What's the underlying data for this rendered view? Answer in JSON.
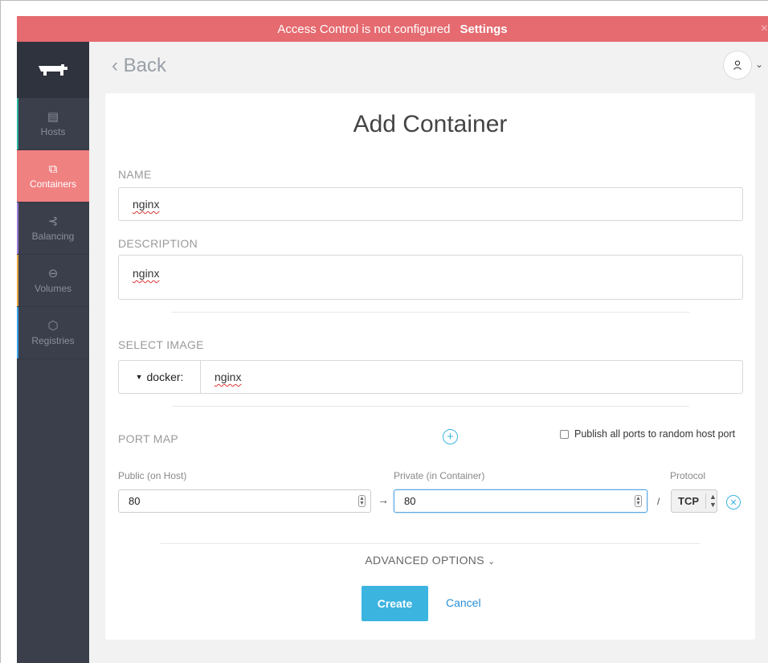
{
  "banner": {
    "message": "Access Control is not configured",
    "link": "Settings",
    "close": "×",
    "color": "#e56b70"
  },
  "sidebar": {
    "items": [
      {
        "label": "Hosts",
        "icon": "hosts-icon",
        "glyph": "▤",
        "accent": "#2bb3a0"
      },
      {
        "label": "Containers",
        "icon": "containers-icon",
        "glyph": "⧉",
        "accent": "#f08181"
      },
      {
        "label": "Balancing",
        "icon": "balancing-icon",
        "glyph": "⊰",
        "accent": "#9b7bd6"
      },
      {
        "label": "Volumes",
        "icon": "volumes-icon",
        "glyph": "⊖",
        "accent": "#e8a23a"
      },
      {
        "label": "Registries",
        "icon": "registries-icon",
        "glyph": "⬡",
        "accent": "#3aa0e8"
      }
    ],
    "active": "Containers"
  },
  "header": {
    "back_label": "Back"
  },
  "form": {
    "title": "Add Container",
    "name_label": "NAME",
    "name_value": "nginx",
    "description_label": "DESCRIPTION",
    "description_value": "nginx",
    "image_label": "SELECT IMAGE",
    "image_prefix": "docker:",
    "image_value": "nginx",
    "port_map_label": "PORT MAP",
    "publish_all_label": "Publish all ports to random host port",
    "public_label": "Public (on Host)",
    "private_label": "Private (in Container)",
    "protocol_label": "Protocol",
    "public_value": "80",
    "private_value": "80",
    "protocol_value": "TCP",
    "arrow": "→",
    "slash": "/",
    "advanced_label": "ADVANCED OPTIONS",
    "create_label": "Create",
    "cancel_label": "Cancel"
  }
}
